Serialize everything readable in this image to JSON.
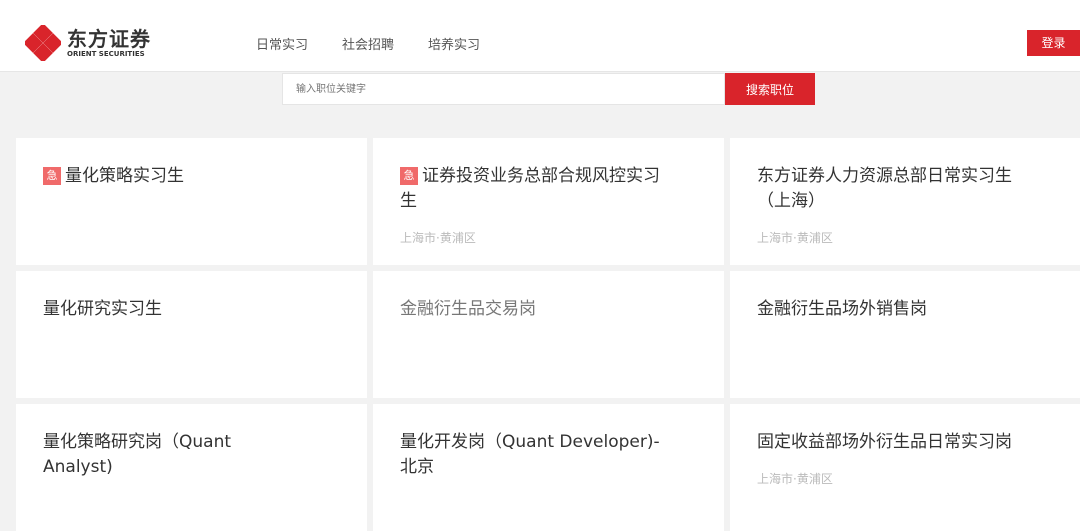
{
  "header": {
    "logo_cn": "东方证券",
    "logo_en": "ORIENT SECURITIES",
    "nav": [
      "日常实习",
      "社会招聘",
      "培养实习"
    ],
    "login": "登录"
  },
  "search": {
    "placeholder": "输入职位关键字",
    "button": "搜索职位"
  },
  "jobs": [
    {
      "title": "量化策略实习生",
      "urgent": "急",
      "location": ""
    },
    {
      "title": "证券投资业务总部合规风控实习生",
      "urgent": "急",
      "location": "上海市·黄浦区"
    },
    {
      "title": "东方证券人力资源总部日常实习生（上海）",
      "urgent": "",
      "location": "上海市·黄浦区"
    },
    {
      "title": "量化研究实习生",
      "urgent": "",
      "location": ""
    },
    {
      "title": "金融衍生品交易岗",
      "urgent": "",
      "location": ""
    },
    {
      "title": "金融衍生品场外销售岗",
      "urgent": "",
      "location": ""
    },
    {
      "title": "量化策略研究岗（Quant Analyst)",
      "urgent": "",
      "location": ""
    },
    {
      "title": "量化开发岗（Quant Developer)-北京",
      "urgent": "",
      "location": ""
    },
    {
      "title": "固定收益部场外衍生品日常实习岗",
      "urgent": "",
      "location": "上海市·黄浦区"
    }
  ]
}
